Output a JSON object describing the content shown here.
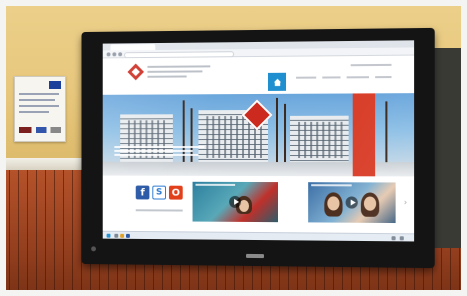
{
  "scene": {
    "subject": "wall-mounted-interactive-display",
    "colors": {
      "wall": "#e7c77c",
      "paneling": "#96401f",
      "bezel": "#141414",
      "site_accent_blue": "#1f8fd0",
      "site_accent_red": "#d9402b",
      "crest_red": "#cc2a1f"
    }
  },
  "website": {
    "social": {
      "facebook_glyph": "f",
      "skype_glyph": "S",
      "office_glyph": "O"
    },
    "icons": {
      "home": "home-icon",
      "play": "play-icon",
      "next": "chevron-right-icon"
    }
  }
}
